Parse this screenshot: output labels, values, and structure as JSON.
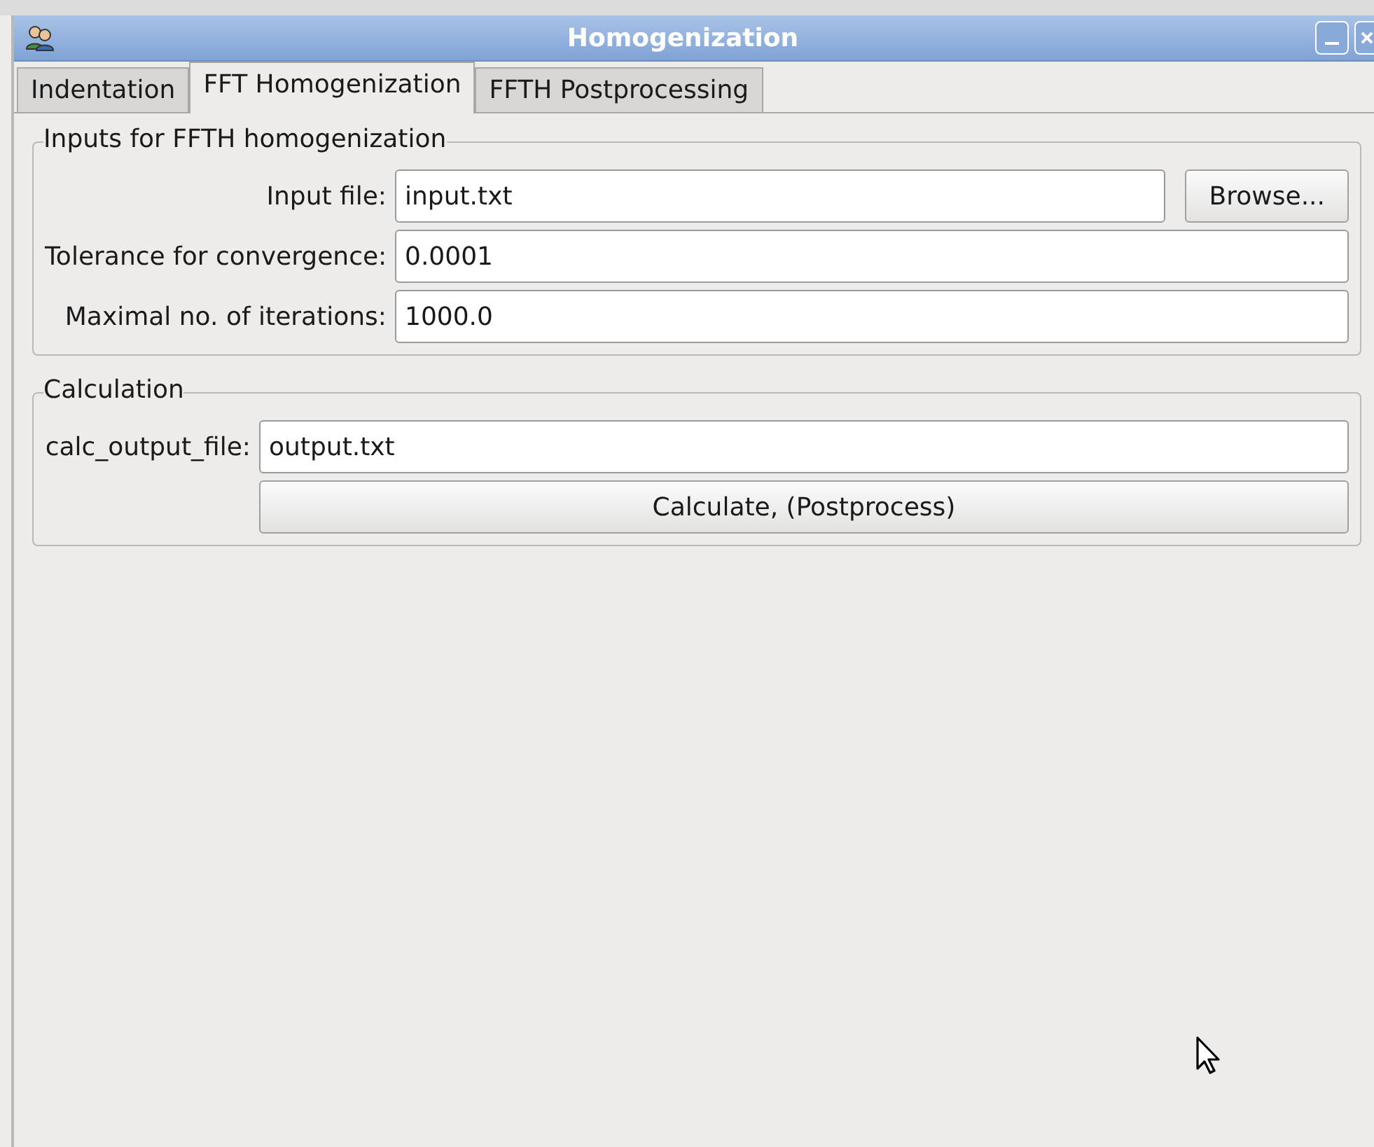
{
  "window": {
    "title": "Homogenization"
  },
  "tabs": [
    {
      "label": "Indentation",
      "selected": false
    },
    {
      "label": "FFT Homogenization",
      "selected": true
    },
    {
      "label": "FFTH Postprocessing",
      "selected": false
    }
  ],
  "groups": [
    {
      "title": "Inputs for FFTH homogenization",
      "fields": [
        {
          "label": "Input file:",
          "value": "input.txt",
          "button": "Browse..."
        },
        {
          "label": "Tolerance for convergence:",
          "value": "0.0001"
        },
        {
          "label": "Maximal no. of iterations:",
          "value": "1000.0"
        }
      ]
    },
    {
      "title": "Calculation",
      "fields": [
        {
          "label": "calc_output_file:",
          "value": "output.txt"
        }
      ],
      "action": "Calculate, (Postprocess)"
    }
  ]
}
